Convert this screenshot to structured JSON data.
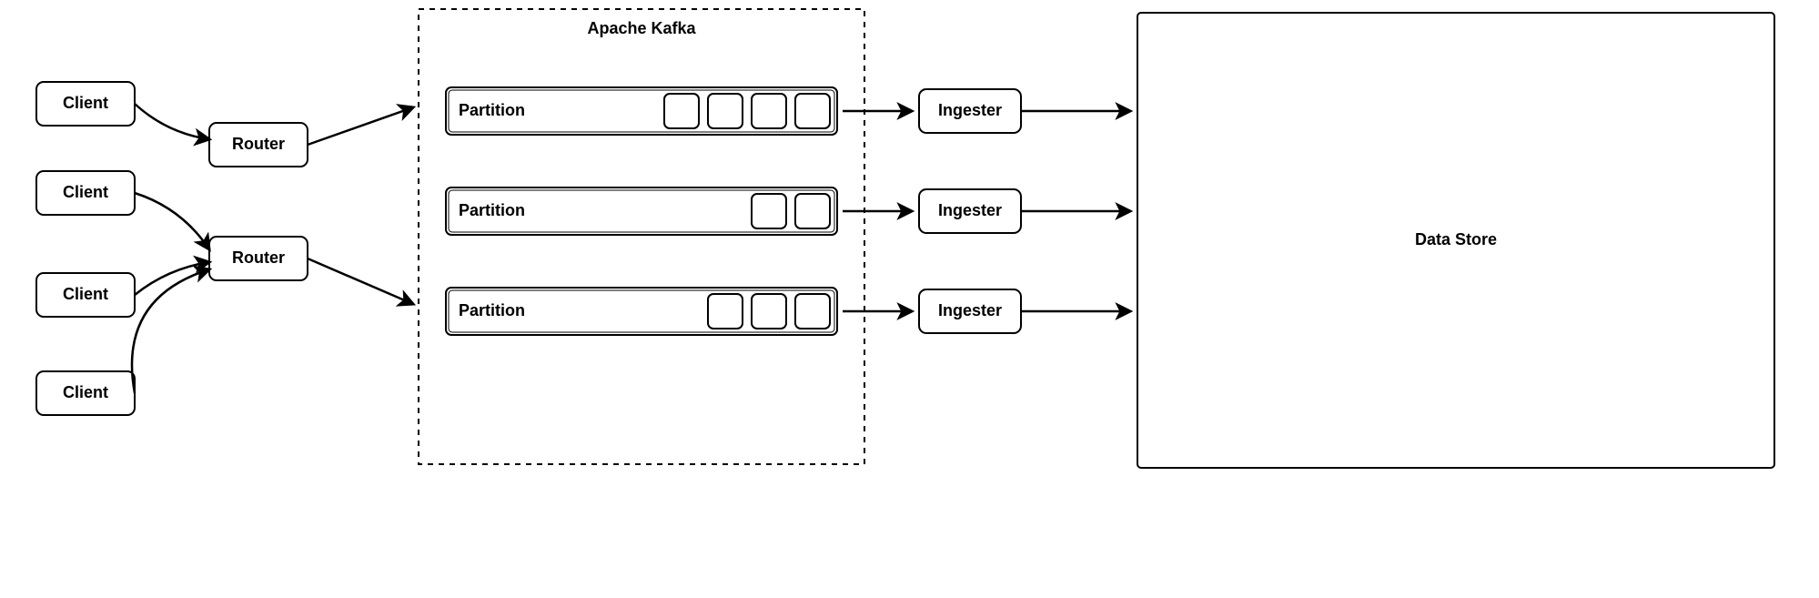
{
  "clients": [
    {
      "label": "Client"
    },
    {
      "label": "Client"
    },
    {
      "label": "Client"
    },
    {
      "label": "Client"
    }
  ],
  "routers": [
    {
      "label": "Router"
    },
    {
      "label": "Router"
    }
  ],
  "kafka": {
    "title": "Apache Kafka",
    "partitions": [
      {
        "label": "Partition",
        "messages": 4
      },
      {
        "label": "Partition",
        "messages": 2
      },
      {
        "label": "Partition",
        "messages": 3
      }
    ]
  },
  "ingesters": [
    {
      "label": "Ingester"
    },
    {
      "label": "Ingester"
    },
    {
      "label": "Ingester"
    }
  ],
  "datastore": {
    "label": "Data Store"
  }
}
